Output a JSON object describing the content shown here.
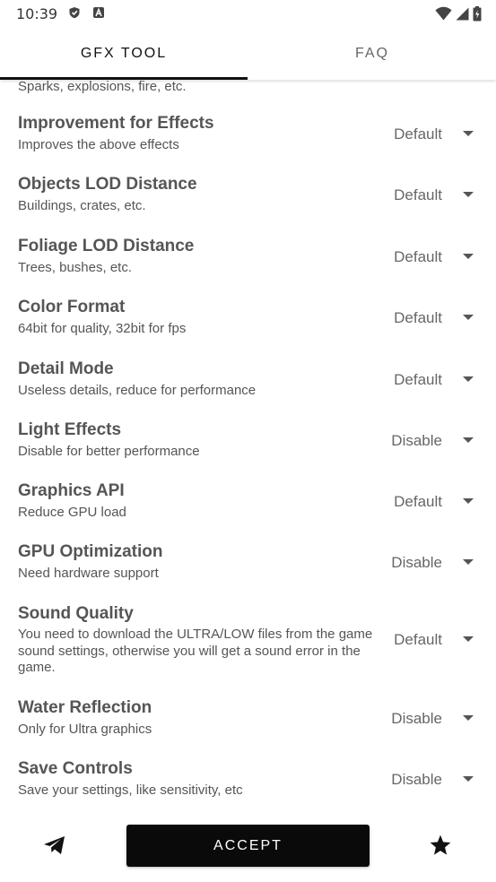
{
  "status_bar": {
    "time": "10:39",
    "left_icons": [
      "shield-icon",
      "a-badge-icon"
    ],
    "right_icons": [
      "wifi-icon",
      "signal-icon",
      "battery-icon"
    ]
  },
  "tabs": [
    {
      "label": "GFX TOOL",
      "active": true
    },
    {
      "label": "FAQ",
      "active": false
    }
  ],
  "list": {
    "partial_description": "Sparks, explosions, fire, etc.",
    "settings": [
      {
        "title": "Improvement for Effects",
        "description": "Improves the above effects",
        "value": "Default"
      },
      {
        "title": "Objects LOD Distance",
        "description": "Buildings, crates, etc.",
        "value": "Default"
      },
      {
        "title": "Foliage LOD Distance",
        "description": "Trees, bushes, etc.",
        "value": "Default"
      },
      {
        "title": "Color Format",
        "description": "64bit for quality, 32bit for fps",
        "value": "Default"
      },
      {
        "title": "Detail Mode",
        "description": "Useless details, reduce for performance",
        "value": "Default"
      },
      {
        "title": "Light Effects",
        "description": "Disable for better performance",
        "value": "Disable"
      },
      {
        "title": "Graphics API",
        "description": "Reduce GPU load",
        "value": "Default"
      },
      {
        "title": "GPU Optimization",
        "description": "Need hardware support",
        "value": "Disable"
      },
      {
        "title": "Sound Quality",
        "description": "You need to download the ULTRA/LOW files from the game sound settings, otherwise you will get a sound error in the game.",
        "value": "Default"
      },
      {
        "title": "Water Reflection",
        "description": "Only for Ultra graphics",
        "value": "Disable"
      },
      {
        "title": "Save Controls",
        "description": "Save your settings, like sensitivity, etc",
        "value": "Disable"
      }
    ]
  },
  "bottom_bar": {
    "accept_label": "ACCEPT",
    "left_icon": "telegram-icon",
    "right_icon": "star-icon"
  },
  "colors": {
    "text": "#555555",
    "accent": "#111111",
    "button_bg": "#0a0a0a",
    "button_text": "#ffffff"
  }
}
